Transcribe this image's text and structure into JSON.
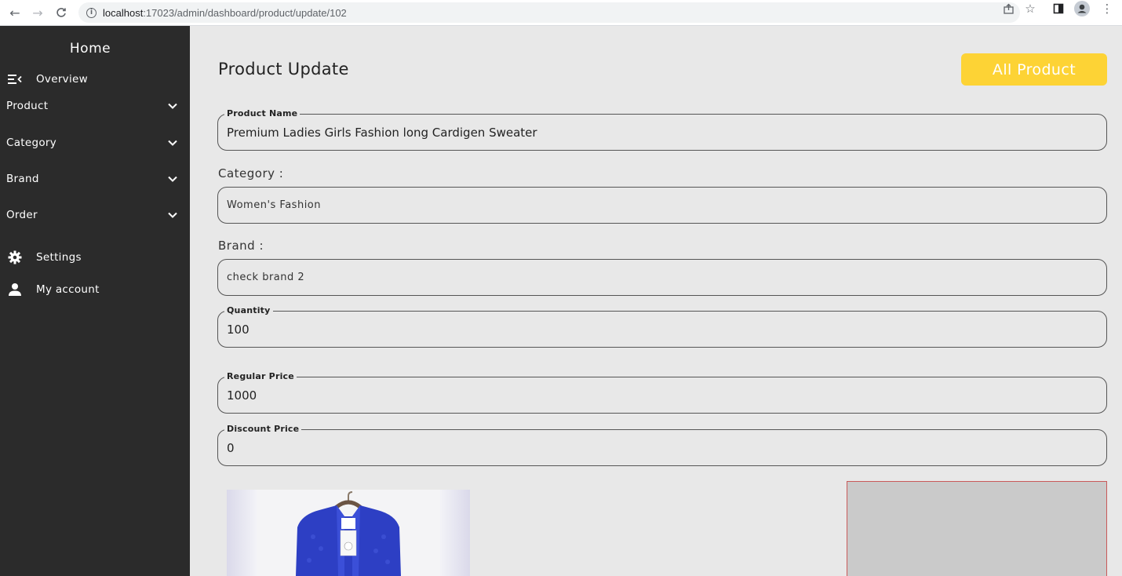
{
  "browser": {
    "url_host": "localhost",
    "url_path": ":17023/admin/dashboard/product/update/102",
    "icons": [
      "back-arrow-icon",
      "forward-arrow-icon",
      "reload-icon",
      "info-icon",
      "share-icon",
      "star-icon",
      "sidepanel-icon",
      "profile-icon",
      "menu-dots-icon"
    ]
  },
  "sidebar": {
    "home": "Home",
    "overview": "Overview",
    "items": [
      {
        "label": "Product"
      },
      {
        "label": "Category"
      },
      {
        "label": "Brand"
      },
      {
        "label": "Order"
      }
    ],
    "settings": "Settings",
    "account": "My account"
  },
  "main": {
    "title": "Product Update",
    "all_product_button": "All Product",
    "product_name": {
      "label": "Product Name",
      "value": "Premium Ladies Girls Fashion long Cardigen Sweater"
    },
    "category": {
      "label": "Category :",
      "value": "Women's Fashion"
    },
    "brand": {
      "label": "Brand :",
      "value": "check brand 2"
    },
    "quantity": {
      "label": "Quantity",
      "value": "100"
    },
    "regular_price": {
      "label": "Regular Price",
      "value": "1000"
    },
    "discount_price": {
      "label": "Discount Price",
      "value": "0"
    }
  },
  "colors": {
    "sidebar_bg": "#2b2b2b",
    "accent_button": "#fdd335",
    "page_bg": "#e8e8e8",
    "product_blue": "#2d3fc4"
  }
}
